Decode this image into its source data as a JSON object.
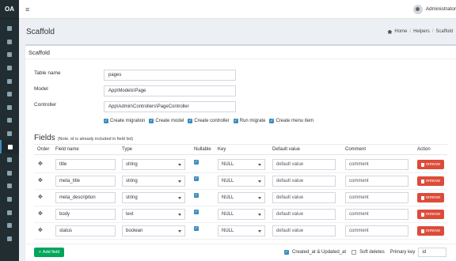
{
  "app": {
    "logo": "OA"
  },
  "sidebar": {
    "icons": [
      "wrench-icon",
      "bar-chart-icon",
      "user-icon",
      "users-icon",
      "building-icon",
      "list-icon",
      "book-icon",
      "tag-icon",
      "file-icon",
      "cog-icon",
      "table-icon",
      "toggle-icon",
      "terminal-icon",
      "gear-icon",
      "database-icon",
      "question-icon",
      "user-circle-icon"
    ],
    "active_index": 9
  },
  "topbar": {
    "menu_icon": "≡",
    "user_name": "Administrator"
  },
  "header": {
    "title": "Scaffold",
    "breadcrumb": {
      "home": "Home",
      "sep1": "/",
      "helpers": "Helpers",
      "sep2": "/",
      "current": "Scaffold"
    }
  },
  "box": {
    "title": "Scaffold",
    "table_name_label": "Table name",
    "table_name_value": "pages",
    "model_label": "Model",
    "model_value": "App\\Models\\Page",
    "controller_label": "Controller",
    "controller_value": "App\\Admin\\Controllers\\PageController",
    "options": [
      {
        "label": "Create migration",
        "checked": true
      },
      {
        "label": "Create model",
        "checked": true
      },
      {
        "label": "Create controller",
        "checked": true
      },
      {
        "label": "Run migrate",
        "checked": true
      },
      {
        "label": "Create menu item",
        "checked": true
      }
    ]
  },
  "fields": {
    "title": "Fields",
    "note": "(Note, id is already included in field list)",
    "headers": {
      "order": "Order",
      "name": "Field name",
      "type": "Type",
      "nullable": "Nullable",
      "key": "Key",
      "default": "Default value",
      "comment": "Comment",
      "action": "Action"
    },
    "rows": [
      {
        "name": "title",
        "type": "string",
        "nullable": true,
        "key": "NULL",
        "default": "default value",
        "comment": "comment"
      },
      {
        "name": "meta_title",
        "type": "string",
        "nullable": true,
        "key": "NULL",
        "default": "default value",
        "comment": "comment"
      },
      {
        "name": "meta_description",
        "type": "string",
        "nullable": true,
        "key": "NULL",
        "default": "default value",
        "comment": "comment"
      },
      {
        "name": "body",
        "type": "text",
        "nullable": true,
        "key": "NULL",
        "default": "default value",
        "comment": "comment"
      },
      {
        "name": "status",
        "type": "boolean",
        "nullable": true,
        "key": "NULL",
        "default": "default value",
        "comment": "comment"
      }
    ],
    "move_glyph": "✥",
    "remove_label": "remove"
  },
  "footer": {
    "add_label": "Add field",
    "timestamps_label": "Created_at & Updated_at",
    "timestamps_checked": true,
    "soft_deletes_label": "Soft deletes",
    "soft_deletes_checked": false,
    "primary_key_label": "Primary key",
    "primary_key_value": "id"
  },
  "colors": {
    "accent": "#3c8dbc",
    "danger": "#dd4b39",
    "success": "#00a65a",
    "sidebar": "#222d32"
  }
}
